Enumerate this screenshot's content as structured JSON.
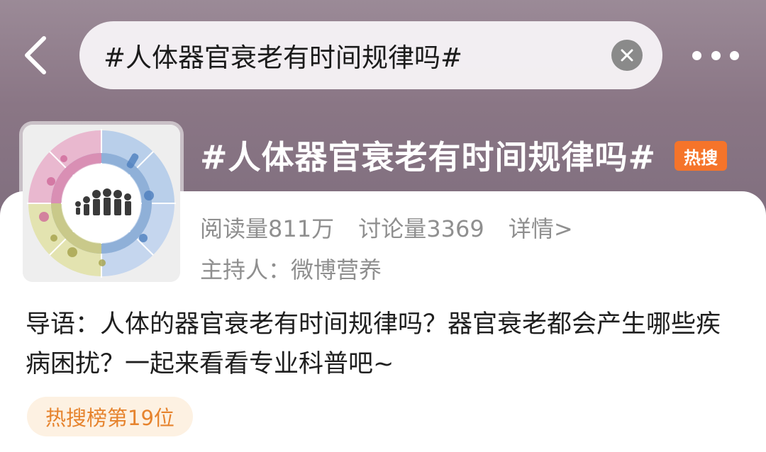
{
  "search": {
    "query": "#人体器官衰老有时间规律吗#"
  },
  "icons": {
    "back": "chevron-left-icon",
    "clear": "close-circle-icon",
    "more": "more-horizontal-icon"
  },
  "topic": {
    "title": "#人体器官衰老有时间规律吗#",
    "badge": "热搜",
    "badge_color": "#f5742a",
    "reads": "阅读量811万",
    "discussions": "讨论量3369",
    "detail_link": "详情>",
    "host": "主持人：微博营养",
    "intro": "导语：人体的器官衰老有时间规律吗？器官衰老都会产生哪些疾病困扰？一起来看看专业科普吧~",
    "rank": "热搜榜第19位",
    "rank_color": "#e6832d"
  }
}
